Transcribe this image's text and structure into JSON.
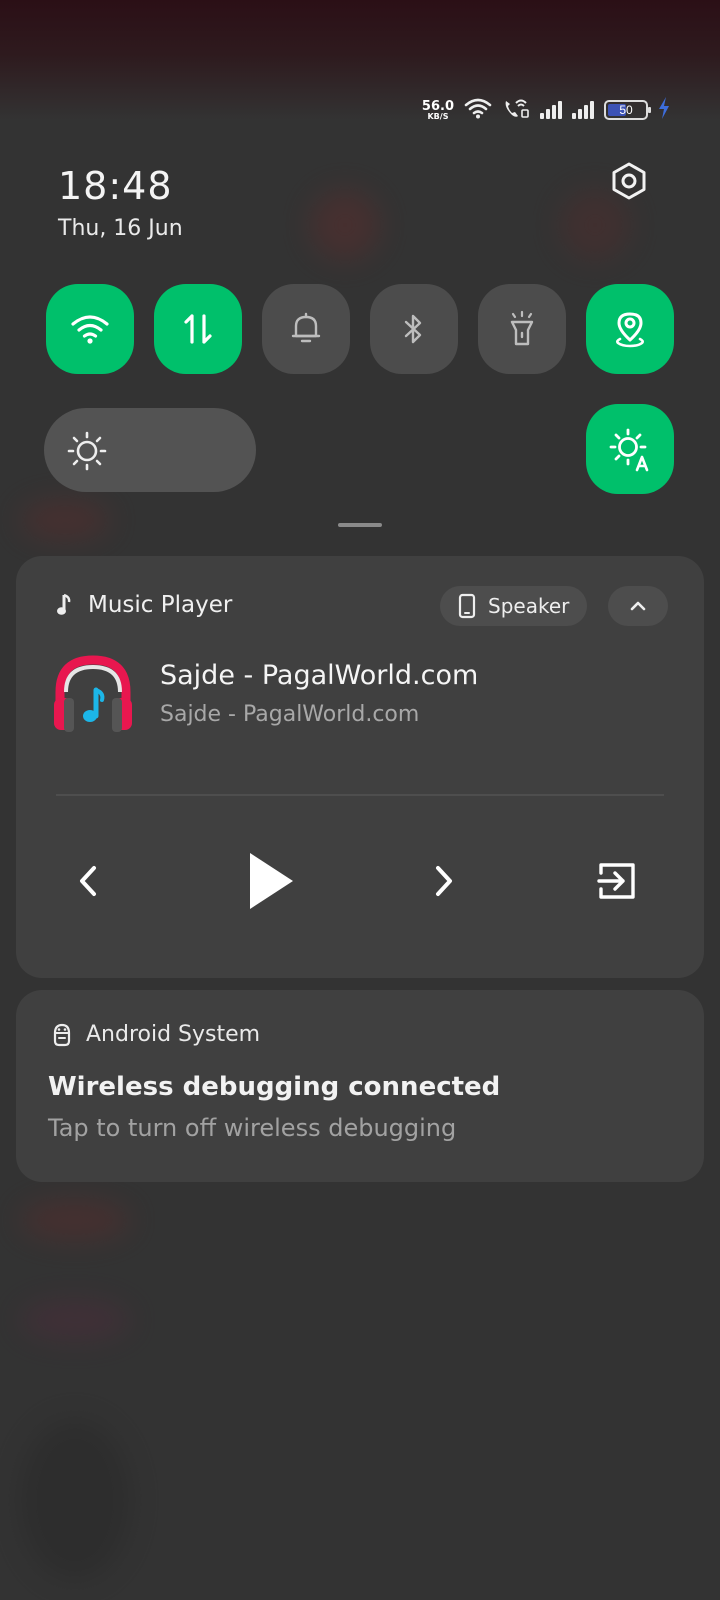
{
  "status_bar": {
    "net_speed_value": "56.0",
    "net_speed_unit": "KB/S",
    "battery_level": "50",
    "charging": true,
    "icons": [
      "wifi-icon",
      "wifi-calling-icon",
      "signal-icon",
      "signal-icon",
      "battery-icon",
      "charging-bolt-icon"
    ]
  },
  "header": {
    "time": "18:48",
    "date": "Thu, 16 Jun",
    "settings_icon": "gear-icon"
  },
  "quick_tiles": [
    {
      "name": "wifi",
      "icon": "wifi-icon",
      "on": true
    },
    {
      "name": "mobile-data",
      "icon": "data-arrows-icon",
      "on": true
    },
    {
      "name": "sound",
      "icon": "bell-icon",
      "on": false
    },
    {
      "name": "bluetooth",
      "icon": "bluetooth-icon",
      "on": false
    },
    {
      "name": "flashlight",
      "icon": "flashlight-icon",
      "on": false
    },
    {
      "name": "location",
      "icon": "location-pin-icon",
      "on": true
    }
  ],
  "brightness": {
    "icon": "sun-icon",
    "auto_icon": "auto-brightness-icon",
    "auto_on": true
  },
  "music_player": {
    "app_name": "Music Player",
    "output_label": "Speaker",
    "track_title": "Sajde - PagalWorld.com",
    "track_subtitle": "Sajde - PagalWorld.com",
    "progress": 0,
    "controls": [
      "previous-icon",
      "play-icon",
      "next-icon",
      "exit-icon"
    ]
  },
  "notification": {
    "app_name": "Android System",
    "title": "Wireless debugging connected",
    "body": "Tap to turn off wireless debugging"
  },
  "colors": {
    "tile_on": "#00c06b",
    "tile_off": "#4c4c4c",
    "card_bg": "#404040",
    "battery_fill": "#3c52b5",
    "charging": "#3d6ddb",
    "album_red": "#e8174f",
    "album_blue": "#1cb6e8"
  }
}
